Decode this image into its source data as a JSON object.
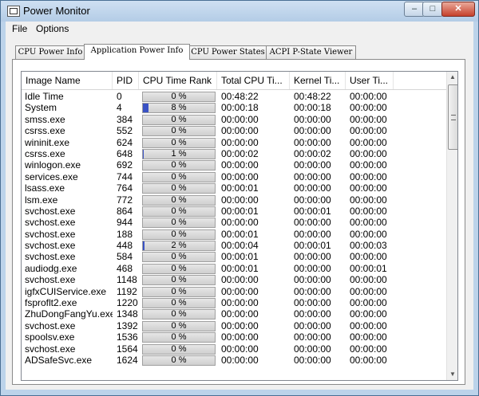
{
  "window": {
    "title": "Power Monitor",
    "controls": {
      "min": "–",
      "max": "□",
      "close": "✕"
    }
  },
  "menu": [
    "File",
    "Options"
  ],
  "tabs": [
    {
      "label": "CPU Power Info",
      "active": false
    },
    {
      "label": "Application Power Info",
      "active": true
    },
    {
      "label": "CPU Power States",
      "active": false
    },
    {
      "label": "ACPI P-State Viewer",
      "active": false
    }
  ],
  "columns": [
    "Image Name",
    "PID",
    "CPU Time Rank",
    "Total CPU Ti...",
    "Kernel Ti...",
    "User Ti..."
  ],
  "rows": [
    {
      "name": "Idle Time",
      "pid": "0",
      "rank": "0 %",
      "rank_value": 0,
      "total": "00:48:22",
      "kernel": "00:48:22",
      "user": "00:00:00"
    },
    {
      "name": "System",
      "pid": "4",
      "rank": "8 %",
      "rank_value": 8,
      "total": "00:00:18",
      "kernel": "00:00:18",
      "user": "00:00:00"
    },
    {
      "name": "smss.exe",
      "pid": "384",
      "rank": "0 %",
      "rank_value": 0,
      "total": "00:00:00",
      "kernel": "00:00:00",
      "user": "00:00:00"
    },
    {
      "name": "csrss.exe",
      "pid": "552",
      "rank": "0 %",
      "rank_value": 0,
      "total": "00:00:00",
      "kernel": "00:00:00",
      "user": "00:00:00"
    },
    {
      "name": "wininit.exe",
      "pid": "624",
      "rank": "0 %",
      "rank_value": 0,
      "total": "00:00:00",
      "kernel": "00:00:00",
      "user": "00:00:00"
    },
    {
      "name": "csrss.exe",
      "pid": "648",
      "rank": "1 %",
      "rank_value": 1,
      "total": "00:00:02",
      "kernel": "00:00:02",
      "user": "00:00:00"
    },
    {
      "name": "winlogon.exe",
      "pid": "692",
      "rank": "0 %",
      "rank_value": 0,
      "total": "00:00:00",
      "kernel": "00:00:00",
      "user": "00:00:00"
    },
    {
      "name": "services.exe",
      "pid": "744",
      "rank": "0 %",
      "rank_value": 0,
      "total": "00:00:00",
      "kernel": "00:00:00",
      "user": "00:00:00"
    },
    {
      "name": "lsass.exe",
      "pid": "764",
      "rank": "0 %",
      "rank_value": 0,
      "total": "00:00:01",
      "kernel": "00:00:00",
      "user": "00:00:00"
    },
    {
      "name": "lsm.exe",
      "pid": "772",
      "rank": "0 %",
      "rank_value": 0,
      "total": "00:00:00",
      "kernel": "00:00:00",
      "user": "00:00:00"
    },
    {
      "name": "svchost.exe",
      "pid": "864",
      "rank": "0 %",
      "rank_value": 0,
      "total": "00:00:01",
      "kernel": "00:00:01",
      "user": "00:00:00"
    },
    {
      "name": "svchost.exe",
      "pid": "944",
      "rank": "0 %",
      "rank_value": 0,
      "total": "00:00:00",
      "kernel": "00:00:00",
      "user": "00:00:00"
    },
    {
      "name": "svchost.exe",
      "pid": "188",
      "rank": "0 %",
      "rank_value": 0,
      "total": "00:00:01",
      "kernel": "00:00:00",
      "user": "00:00:00"
    },
    {
      "name": "svchost.exe",
      "pid": "448",
      "rank": "2 %",
      "rank_value": 2,
      "total": "00:00:04",
      "kernel": "00:00:01",
      "user": "00:00:03"
    },
    {
      "name": "svchost.exe",
      "pid": "584",
      "rank": "0 %",
      "rank_value": 0,
      "total": "00:00:01",
      "kernel": "00:00:00",
      "user": "00:00:00"
    },
    {
      "name": "audiodg.exe",
      "pid": "468",
      "rank": "0 %",
      "rank_value": 0,
      "total": "00:00:01",
      "kernel": "00:00:00",
      "user": "00:00:01"
    },
    {
      "name": "svchost.exe",
      "pid": "1148",
      "rank": "0 %",
      "rank_value": 0,
      "total": "00:00:00",
      "kernel": "00:00:00",
      "user": "00:00:00"
    },
    {
      "name": "igfxCUIService.exe",
      "pid": "1192",
      "rank": "0 %",
      "rank_value": 0,
      "total": "00:00:00",
      "kernel": "00:00:00",
      "user": "00:00:00"
    },
    {
      "name": "fsproflt2.exe",
      "pid": "1220",
      "rank": "0 %",
      "rank_value": 0,
      "total": "00:00:00",
      "kernel": "00:00:00",
      "user": "00:00:00"
    },
    {
      "name": "ZhuDongFangYu.exe",
      "pid": "1348",
      "rank": "0 %",
      "rank_value": 0,
      "total": "00:00:00",
      "kernel": "00:00:00",
      "user": "00:00:00"
    },
    {
      "name": "svchost.exe",
      "pid": "1392",
      "rank": "0 %",
      "rank_value": 0,
      "total": "00:00:00",
      "kernel": "00:00:00",
      "user": "00:00:00"
    },
    {
      "name": "spoolsv.exe",
      "pid": "1536",
      "rank": "0 %",
      "rank_value": 0,
      "total": "00:00:00",
      "kernel": "00:00:00",
      "user": "00:00:00"
    },
    {
      "name": "svchost.exe",
      "pid": "1564",
      "rank": "0 %",
      "rank_value": 0,
      "total": "00:00:00",
      "kernel": "00:00:00",
      "user": "00:00:00"
    },
    {
      "name": "ADSafeSvc.exe",
      "pid": "1624",
      "rank": "0 %",
      "rank_value": 0,
      "total": "00:00:00",
      "kernel": "00:00:00",
      "user": "00:00:00"
    }
  ],
  "colors": {
    "rank_bar": "#3a52c4",
    "window_frame": "#bcd3ea",
    "close_button": "#c6402b"
  },
  "icons": [
    "app-icon",
    "minimize-icon",
    "maximize-icon",
    "close-icon",
    "scroll-up-arrow-icon",
    "scroll-down-arrow-icon",
    "scroll-grip-icon"
  ]
}
